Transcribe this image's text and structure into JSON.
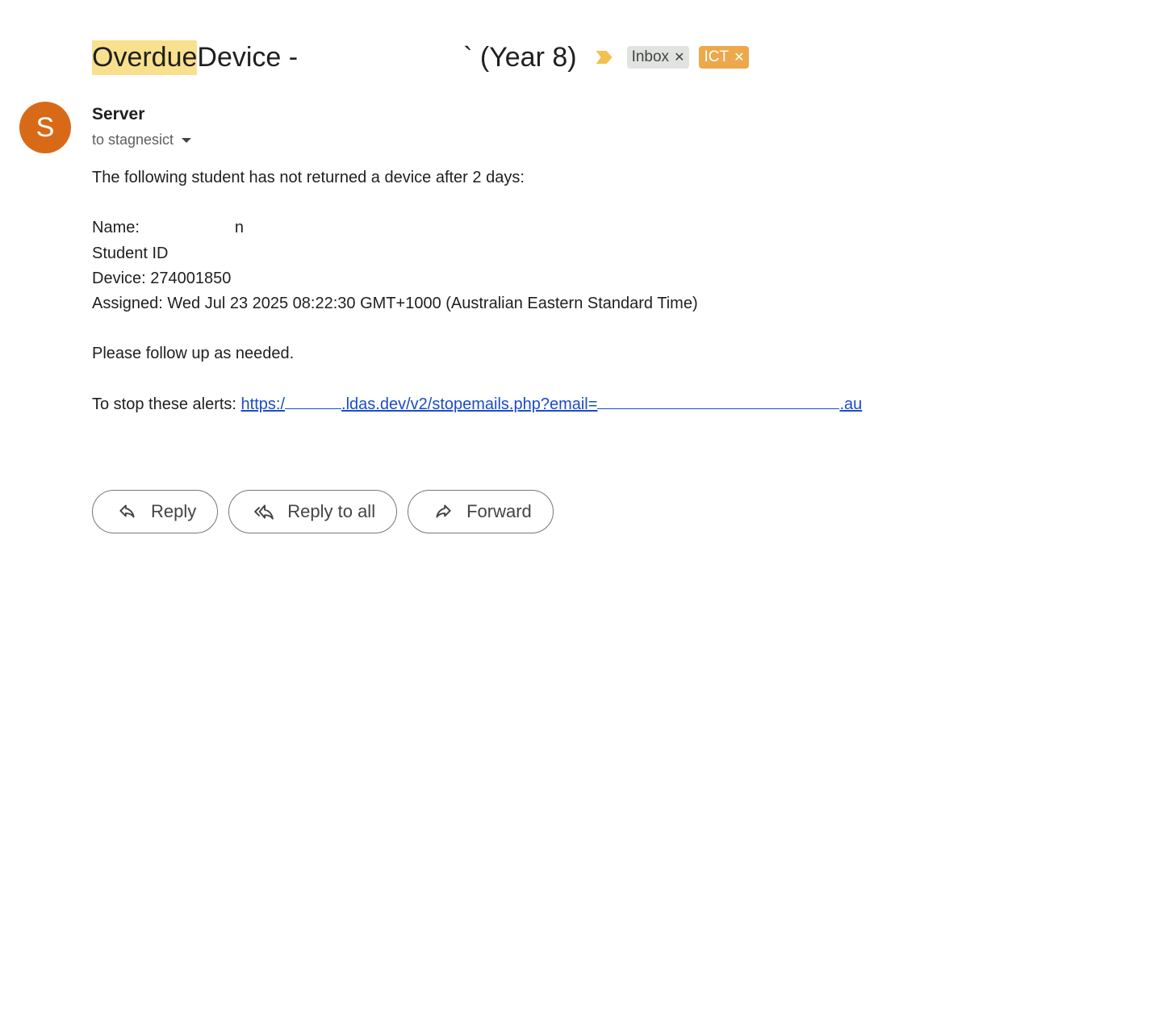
{
  "subject": {
    "highlight": "Overdue",
    "text_before_redaction": " Device -",
    "text_after_redaction": "` (Year 8)"
  },
  "labels": [
    {
      "name": "Inbox",
      "color": "#e1e3e1"
    },
    {
      "name": "ICT",
      "color": "#eda84c"
    }
  ],
  "sender": {
    "initial": "S",
    "name": "Server",
    "to": "to stagnesict",
    "avatar_color": "#d86a17"
  },
  "body": {
    "intro": "The following student has not returned a device after 2 days:",
    "name_label": "Name:",
    "name_fragment": "n",
    "student_id_label": "Student ID",
    "device": "Device: 274001850",
    "assigned": "Assigned: Wed Jul 23 2025 08:22:30 GMT+1000 (Australian Eastern Standard Time)",
    "follow_up": "Please follow up as needed.",
    "stop_label": "To stop these alerts: ",
    "link_start": "https:/",
    "link_middle": ".ldas.dev/v2/stopemails.php?email=",
    "link_end": ".au"
  },
  "actions": {
    "reply": "Reply",
    "reply_all": "Reply to all",
    "forward": "Forward"
  }
}
